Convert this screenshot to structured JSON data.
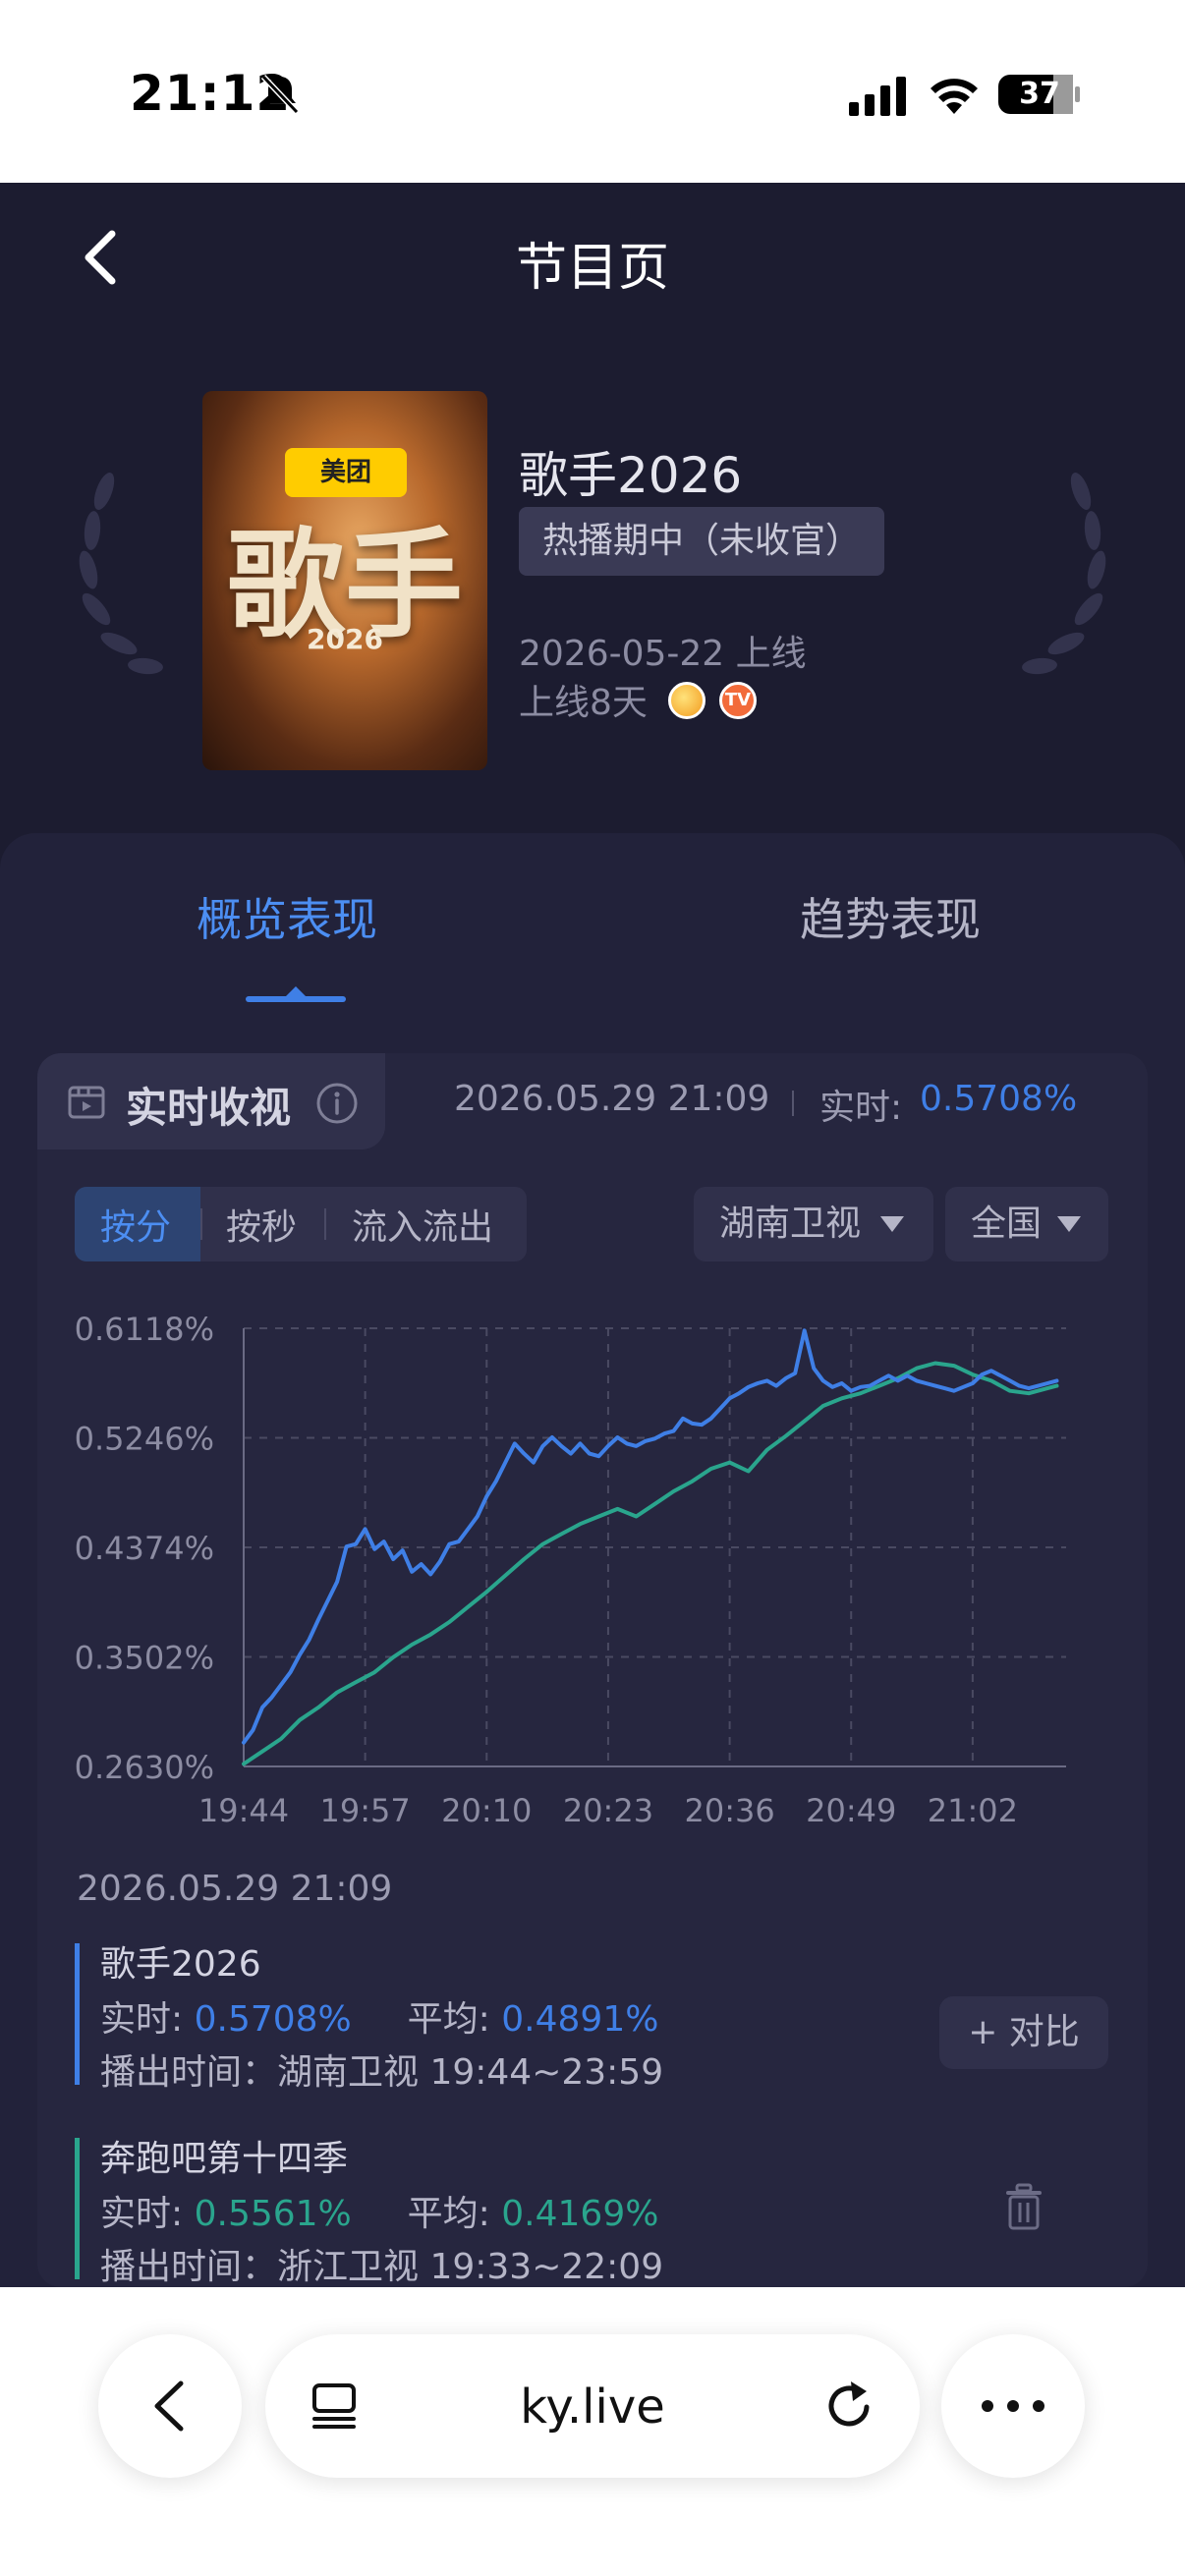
{
  "status_bar": {
    "time": "21:12",
    "battery": "37"
  },
  "header": {
    "title": "节目页"
  },
  "show": {
    "poster_brand": "美团",
    "poster_title": "歌手",
    "poster_year": "2026",
    "name": "歌手2026",
    "status": "热播期中（未收官）",
    "release_date": "2026-05-22 上线",
    "days_online": "上线8天"
  },
  "tabs": {
    "overview": "概览表现",
    "trend": "趋势表现"
  },
  "realtime": {
    "label": "实时收视",
    "timestamp": "2026.05.29 21:09",
    "now_label": "实时:",
    "now_value": "0.5708%"
  },
  "segments": [
    "按分",
    "按秒",
    "流入流出"
  ],
  "dropdowns": {
    "channel": "湖南卫视",
    "region": "全国"
  },
  "chart_data": {
    "type": "line",
    "y_ticks": [
      "0.6118%",
      "0.5246%",
      "0.4374%",
      "0.3502%",
      "0.2630%"
    ],
    "x_ticks": [
      "19:44",
      "19:57",
      "20:10",
      "20:23",
      "20:36",
      "20:49",
      "21:02"
    ],
    "ylim": [
      0.263,
      0.6118
    ],
    "xlim_minutes": [
      0,
      88
    ],
    "grid": true,
    "series": [
      {
        "name": "歌手2026",
        "color": "#3f7fe6",
        "x": [
          0,
          1,
          2,
          3,
          4,
          5,
          6,
          7,
          8,
          9,
          10,
          11,
          12,
          13,
          14,
          15,
          16,
          17,
          18,
          19,
          20,
          21,
          22,
          23,
          24,
          25,
          26,
          27,
          28,
          29,
          30,
          31,
          32,
          33,
          34,
          35,
          36,
          37,
          38,
          39,
          40,
          41,
          42,
          43,
          44,
          45,
          46,
          47,
          48,
          49,
          50,
          51,
          52,
          53,
          54,
          55,
          56,
          57,
          58,
          59,
          60,
          61,
          62,
          63,
          64,
          65,
          66,
          67,
          68,
          69,
          70,
          71,
          72,
          73,
          74,
          75,
          76,
          77,
          78,
          79,
          80,
          81,
          82,
          83,
          84,
          85,
          86,
          87
        ],
        "values": [
          0.282,
          0.292,
          0.31,
          0.318,
          0.328,
          0.338,
          0.352,
          0.364,
          0.38,
          0.395,
          0.41,
          0.438,
          0.44,
          0.452,
          0.436,
          0.442,
          0.428,
          0.435,
          0.418,
          0.424,
          0.416,
          0.426,
          0.44,
          0.442,
          0.452,
          0.462,
          0.478,
          0.49,
          0.505,
          0.52,
          0.512,
          0.505,
          0.518,
          0.525,
          0.518,
          0.512,
          0.52,
          0.512,
          0.51,
          0.518,
          0.525,
          0.52,
          0.518,
          0.522,
          0.524,
          0.528,
          0.53,
          0.54,
          0.536,
          0.535,
          0.54,
          0.548,
          0.556,
          0.56,
          0.565,
          0.568,
          0.57,
          0.566,
          0.572,
          0.576,
          0.61,
          0.58,
          0.57,
          0.565,
          0.568,
          0.562,
          0.565,
          0.566,
          0.57,
          0.574,
          0.57,
          0.574,
          0.57,
          0.568,
          0.566,
          0.564,
          0.562,
          0.565,
          0.568,
          0.575,
          0.578,
          0.574,
          0.57,
          0.566,
          0.564,
          0.566,
          0.568,
          0.57
        ]
      },
      {
        "name": "奔跑吧第十四季",
        "color": "#2aa58d",
        "x": [
          0,
          2,
          4,
          6,
          8,
          10,
          12,
          14,
          16,
          18,
          20,
          22,
          24,
          26,
          28,
          30,
          32,
          34,
          36,
          38,
          40,
          42,
          44,
          46,
          48,
          50,
          52,
          54,
          56,
          58,
          60,
          62,
          64,
          66,
          68,
          70,
          72,
          74,
          76,
          78,
          80,
          82,
          84,
          86,
          87
        ],
        "values": [
          0.265,
          0.275,
          0.285,
          0.3,
          0.31,
          0.322,
          0.33,
          0.338,
          0.35,
          0.36,
          0.368,
          0.378,
          0.39,
          0.402,
          0.415,
          0.428,
          0.44,
          0.448,
          0.456,
          0.462,
          0.468,
          0.462,
          0.472,
          0.482,
          0.49,
          0.5,
          0.505,
          0.498,
          0.515,
          0.526,
          0.538,
          0.55,
          0.556,
          0.56,
          0.566,
          0.572,
          0.58,
          0.584,
          0.582,
          0.575,
          0.57,
          0.562,
          0.56,
          0.564,
          0.566
        ]
      }
    ]
  },
  "legend": {
    "timestamp": "2026.05.29 21:09",
    "entries": [
      {
        "name": "歌手2026",
        "now_label": "实时:",
        "now": "0.5708%",
        "avg_label": "平均:",
        "avg": "0.4891%",
        "airtime": "播出时间：湖南卫视 19:44~23:59"
      },
      {
        "name": "奔跑吧第十四季",
        "now_label": "实时:",
        "now": "0.5561%",
        "avg_label": "平均:",
        "avg": "0.4169%",
        "airtime": "播出时间：浙江卫视 19:33~22:09"
      }
    ],
    "compare_label": "+ 对比"
  },
  "browser": {
    "url": "ky.live"
  }
}
